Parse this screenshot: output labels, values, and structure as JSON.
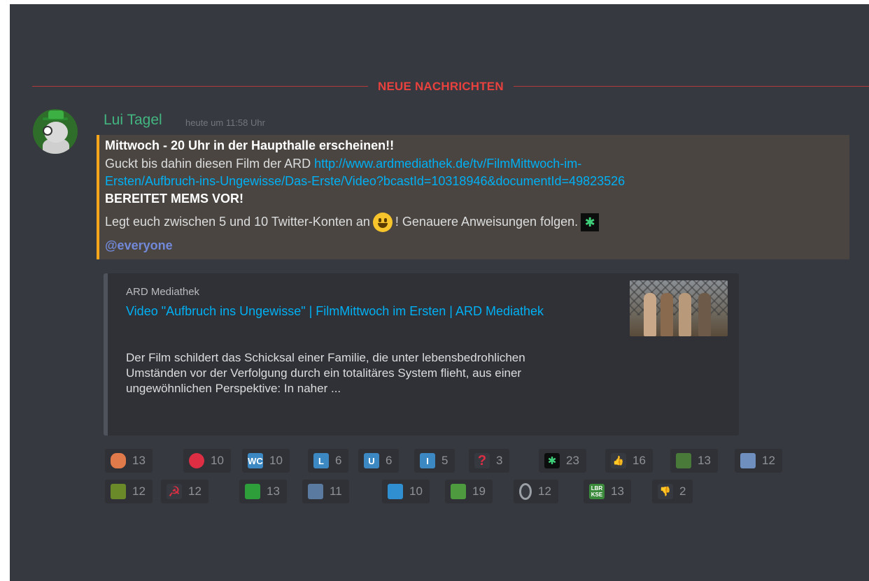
{
  "divider": {
    "label": "NEUE NACHRICHTEN"
  },
  "message": {
    "author": "Lui Tagel",
    "timestamp": "heute um 11:58 Uhr",
    "line1": "Mittwoch - 20 Uhr in der Haupthalle erscheinen!!",
    "line2_text": "Guckt bis dahin diesen Film der ARD ",
    "line2_link": "http://www.ardmediathek.de/tv/FilmMittwoch-im-",
    "line3_link": "Ersten/Aufbruch-ins-Ungewisse/Das-Erste/Video?bcastId=10318946&documentId=49823526",
    "line4": "BEREITET MEMS VOR!",
    "line5_a": "Legt euch zwischen 5 und 10 Twitter-Konten an",
    "line5_b": "! Genauere Anweisungen folgen.",
    "mention": "@everyone"
  },
  "embed": {
    "provider": "ARD Mediathek",
    "title": "Video \"Aufbruch ins Ungewisse\" | FilmMittwoch im Ersten | ARD Mediathek",
    "description": "Der Film schildert das Schicksal einer Familie, die unter lebensbedrohlichen Umständen vor der Verfolgung durch ein totalitäres System flieht, aus einer ungewöhnlichen Perspektive: In naher ..."
  },
  "reactions_row1": [
    {
      "icon": "bear-face-icon",
      "glyph": "",
      "color": "#e07a4a",
      "count": "13"
    },
    {
      "icon": "red-circle-icon",
      "glyph": "",
      "color": "#dd2e44",
      "count": "10"
    },
    {
      "icon": "wc-icon",
      "glyph": "WC",
      "color": "#3b88c3",
      "count": "10"
    },
    {
      "icon": "regional-l-icon",
      "glyph": "L",
      "color": "#3b88c3",
      "count": "6"
    },
    {
      "icon": "regional-u-icon",
      "glyph": "U",
      "color": "#3b88c3",
      "count": "6"
    },
    {
      "icon": "regional-i-icon",
      "glyph": "I",
      "color": "#3b88c3",
      "count": "5"
    },
    {
      "icon": "red-question-icon",
      "glyph": "?",
      "color": "#36393f",
      "count": "3"
    },
    {
      "icon": "bluetooth-icon",
      "glyph": "✱",
      "color": "#0b0e0c",
      "count": "23"
    },
    {
      "icon": "thumbs-up-icon",
      "glyph": "👍",
      "color": "#36393f",
      "count": "16"
    },
    {
      "icon": "pepe-icon",
      "glyph": "",
      "color": "#4a7a3a",
      "count": "13"
    },
    {
      "icon": "sparkle-icon",
      "glyph": "",
      "color": "#6f8fbf",
      "count": "12"
    }
  ],
  "reactions_row2": [
    {
      "icon": "plant-icon",
      "glyph": "",
      "color": "#6a8a2a",
      "count": "12"
    },
    {
      "icon": "hammer-sickle-icon",
      "glyph": "☭",
      "color": "#36393f",
      "count": "12"
    },
    {
      "icon": "green-globe-icon",
      "glyph": "",
      "color": "#2e9e3a",
      "count": "13"
    },
    {
      "icon": "wave-meme-icon",
      "glyph": "",
      "color": "#5a7aa0",
      "count": "11"
    },
    {
      "icon": "blue-wave-icon",
      "glyph": "",
      "color": "#2f8fd0",
      "count": "10"
    },
    {
      "icon": "frog-icon",
      "glyph": "",
      "color": "#4e9a3e",
      "count": "19"
    },
    {
      "icon": "ring-icon",
      "glyph": "",
      "color": "#36393f",
      "count": "12"
    },
    {
      "icon": "lbr-kse-icon",
      "glyph": "LBR KSE",
      "color": "#3b8a3b",
      "count": "13"
    },
    {
      "icon": "thumbs-down-icon",
      "glyph": "👎",
      "color": "#36393f",
      "count": "2"
    }
  ]
}
